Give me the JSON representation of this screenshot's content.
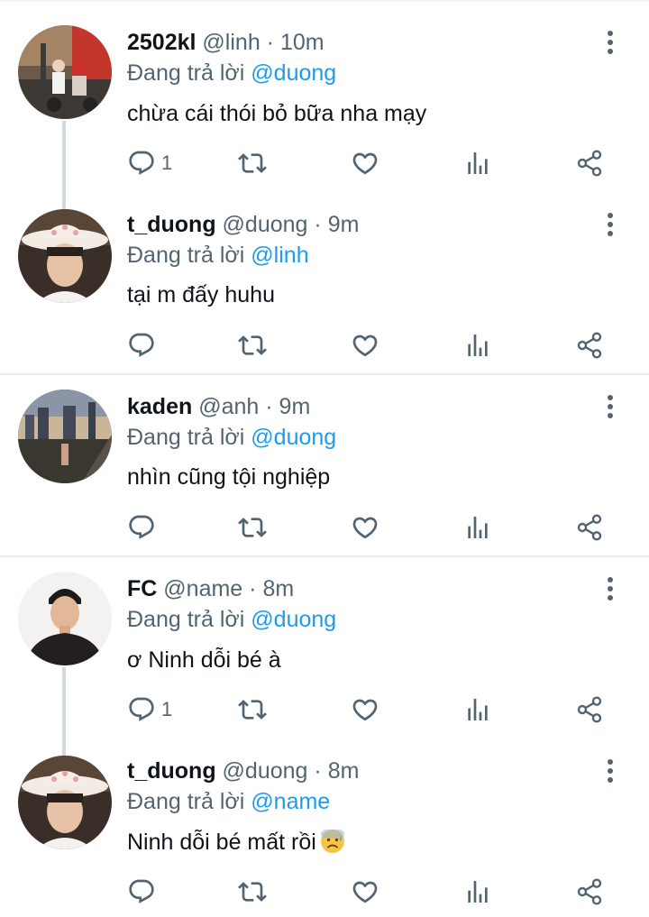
{
  "tweets": [
    {
      "name": "2502kl",
      "handle": "@linh",
      "time": "10m",
      "reply_prefix": "Đang trả lời",
      "reply_to": "@duong",
      "text": "chừa cái thói bỏ bữa nha mạy",
      "reply_count": "1",
      "avatar": "street-photo-avatar"
    },
    {
      "name": "t_duong",
      "handle": "@duong",
      "time": "9m",
      "reply_prefix": "Đang trả lời",
      "reply_to": "@linh",
      "text": "tại m đấy huhu",
      "reply_count": "",
      "avatar": "cowboy-hat-avatar"
    },
    {
      "name": "kaden",
      "handle": "@anh",
      "time": "9m",
      "reply_prefix": "Đang trả lời",
      "reply_to": "@duong",
      "text": "nhìn cũng tội nghiệp",
      "reply_count": "",
      "avatar": "city-bridge-avatar"
    },
    {
      "name": "FC",
      "handle": "@name",
      "time": "8m",
      "reply_prefix": "Đang trả lời",
      "reply_to": "@duong",
      "text": "ơ Ninh dỗi bé à",
      "reply_count": "1",
      "avatar": "portrait-avatar"
    },
    {
      "name": "t_duong",
      "handle": "@duong",
      "time": "8m",
      "reply_prefix": "Đang trả lời",
      "reply_to": "@name",
      "text": "Ninh dỗi bé mất rồi",
      "emoji": "sad-but-relieved-face-emoji",
      "reply_count": "",
      "avatar": "cowboy-hat-avatar"
    }
  ],
  "separator_dot": "·",
  "colors": {
    "mention": "#1d9bf0",
    "secondary_text": "#536471",
    "separator": "#e6ecf0"
  },
  "icons": [
    "reply-icon",
    "retweet-icon",
    "like-icon",
    "views-icon",
    "share-icon",
    "more-icon"
  ]
}
